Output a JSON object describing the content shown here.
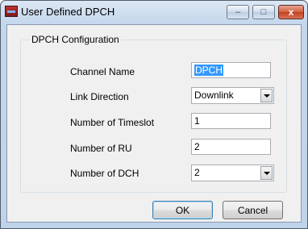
{
  "window": {
    "title": "User Defined DPCH",
    "minimize_glyph": "–",
    "maximize_glyph": "□",
    "close_glyph": "x"
  },
  "group": {
    "title": "DPCH Configuration"
  },
  "fields": {
    "channel_name": {
      "label": "Channel Name",
      "value": "DPCH"
    },
    "link_direction": {
      "label": "Link Direction",
      "value": "Downlink"
    },
    "num_timeslot": {
      "label": "Number of Timeslot",
      "value": "1"
    },
    "num_ru": {
      "label": "Number of RU",
      "value": "2"
    },
    "num_dch": {
      "label": "Number of DCH",
      "value": "2"
    }
  },
  "buttons": {
    "ok": "OK",
    "cancel": "Cancel"
  }
}
